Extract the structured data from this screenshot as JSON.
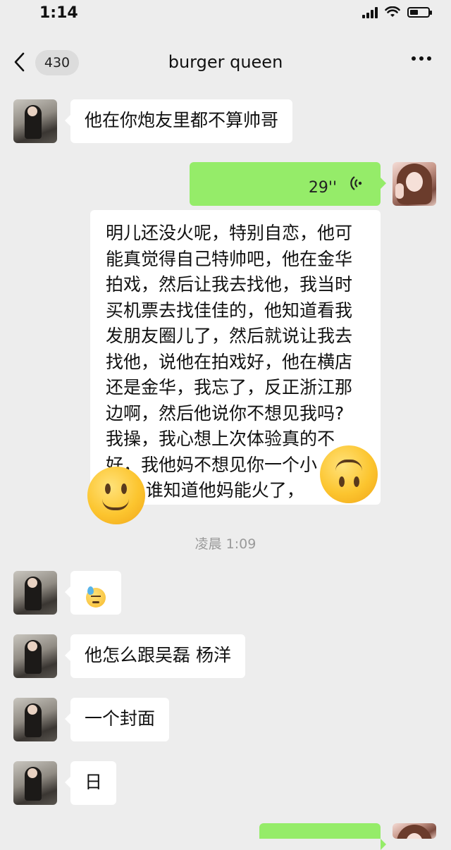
{
  "status_bar": {
    "time": "1:14",
    "battery_level": 0.45
  },
  "nav": {
    "back_icon": "chevron-left-icon",
    "unread_count": "430",
    "title": "burger queen",
    "more_icon": "ellipsis-icon"
  },
  "messages": [
    {
      "side": "left",
      "type": "text",
      "text": "他在你炮友里都不算帅哥"
    },
    {
      "side": "right",
      "type": "voice",
      "duration": "29''"
    },
    {
      "side": "right",
      "type": "transcript",
      "lines": [
        "明儿还没火呢，特别自恋，他可",
        "能真觉得自己特帅吧，他在金华",
        "拍戏，然后让我去找他，我当时",
        "买机票去找佳佳的，他知道看我",
        "发朋友圈儿了，然后就说让我去",
        "找他，说他在拍戏好，他在横店",
        "还是金华，我忘了，反正浙江那",
        "边啊，然后他说你不想见我吗?",
        "我操，我心想上次体验真的不",
        "好，我他妈不想见你一个小",
        "    ，谁知道他妈能火了，"
      ]
    },
    {
      "side": "left",
      "type": "emoji",
      "emoji": "downcast-sweat-icon"
    },
    {
      "side": "left",
      "type": "text",
      "text": "他怎么跟吴磊 杨洋"
    },
    {
      "side": "left",
      "type": "text",
      "text": "一个封面"
    },
    {
      "side": "left",
      "type": "text",
      "text": "日"
    }
  ],
  "timestamp": "凌晨 1:09",
  "overlay_emojis": [
    "slightly-smiling-face-icon",
    "upside-down-face-icon"
  ],
  "colors": {
    "background": "#ededed",
    "bubble_self": "#95ec69",
    "bubble_other": "#ffffff"
  }
}
